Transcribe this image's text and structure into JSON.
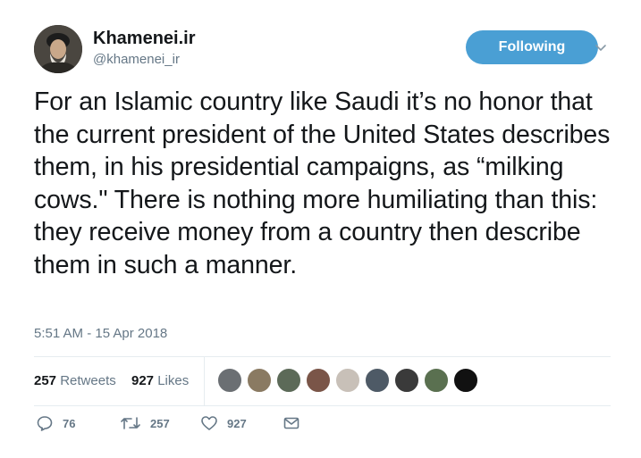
{
  "tweet": {
    "display_name": "Khamenei.ir",
    "handle": "@khamenei_ir",
    "follow_label": "Following",
    "text": "For an Islamic country like Saudi it’s no honor that the current president of the United States describes them, in his presidential campaigns, as “milking cows.\" There is nothing more humiliating than this: they receive money from a country then describe them in such a manner.",
    "timestamp": "5:51 AM - 15 Apr 2018"
  },
  "stats": {
    "retweets_count": "257",
    "retweets_label": "Retweets",
    "likes_count": "927",
    "likes_label": "Likes"
  },
  "actions": {
    "reply_count": "76",
    "retweet_count": "257",
    "like_count": "927"
  },
  "colors": {
    "accent": "#4a9fd4",
    "secondary_text": "#657786",
    "divider": "#e6ecf0"
  }
}
